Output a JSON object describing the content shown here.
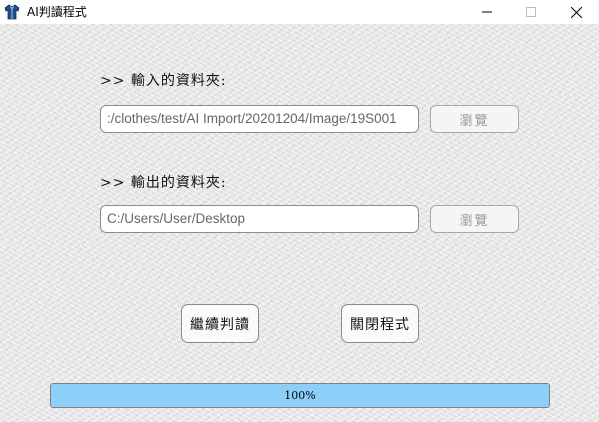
{
  "window": {
    "title": "AI判讀程式",
    "icon": "jacket-icon"
  },
  "input_section": {
    "label": ">> 輸入的資料夾:",
    "path_value": ":/clothes/test/AI Import/20201204/Image/19S001",
    "browse_label": "瀏覽"
  },
  "output_section": {
    "label": ">> 輸出的資料夾:",
    "path_value": "C:/Users/User/Desktop",
    "browse_label": "瀏覽"
  },
  "actions": {
    "continue_label": "繼續判讀",
    "close_label": "關閉程式"
  },
  "progress": {
    "percent": 100,
    "text": "100%"
  },
  "colors": {
    "progress_fill": "#8ccff9",
    "field_border": "#8c8c8c"
  }
}
